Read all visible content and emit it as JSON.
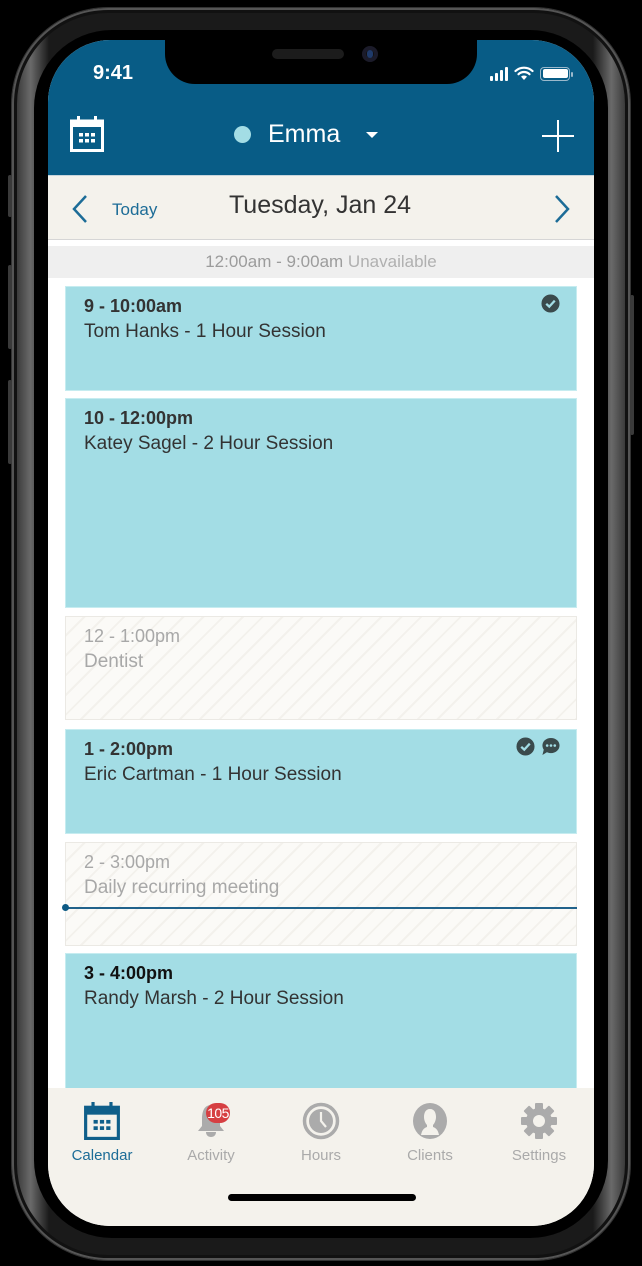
{
  "status_bar": {
    "time": "9:41"
  },
  "header": {
    "user_name": "Emma",
    "user_color": "#a3dde5",
    "calendar_icon": "calendar-icon",
    "add_icon": "plus-icon",
    "dropdown_icon": "caret-down-icon"
  },
  "date_nav": {
    "today_label": "Today",
    "date": "Tuesday, Jan 24",
    "prev_icon": "chevron-left-icon",
    "next_icon": "chevron-right-icon"
  },
  "unavailable": {
    "range": "12:00am - 9:00am",
    "label": "Unavailable"
  },
  "events": [
    {
      "time": "9 - 10:00am",
      "title": "Tom Hanks - 1 Hour Session",
      "type": "session",
      "icons": [
        "check-circle-icon"
      ]
    },
    {
      "time": "10 - 12:00pm",
      "title": "Katey Sagel - 2 Hour Session",
      "type": "session",
      "icons": []
    },
    {
      "time": "12 - 1:00pm",
      "title": "Dentist",
      "type": "block",
      "icons": []
    },
    {
      "time": "1 - 2:00pm",
      "title": "Eric Cartman - 1 Hour Session",
      "type": "session",
      "icons": [
        "check-circle-icon",
        "chat-bubble-icon"
      ]
    },
    {
      "time": "2 - 3:00pm",
      "title": "Daily recurring meeting",
      "type": "block",
      "icons": []
    },
    {
      "time": "3 - 4:00pm",
      "title": "Randy Marsh - 2 Hour Session",
      "type": "session",
      "icons": []
    }
  ],
  "tabs": [
    {
      "label": "Calendar",
      "icon": "calendar-icon",
      "active": true
    },
    {
      "label": "Activity",
      "icon": "bell-icon",
      "badge": "105"
    },
    {
      "label": "Hours",
      "icon": "clock-icon"
    },
    {
      "label": "Clients",
      "icon": "person-icon"
    },
    {
      "label": "Settings",
      "icon": "gear-icon"
    }
  ],
  "colors": {
    "header_bg": "#085c86",
    "accent": "#1c6c97",
    "session_bg": "#a3dde5",
    "badge_bg": "#d63f42"
  }
}
